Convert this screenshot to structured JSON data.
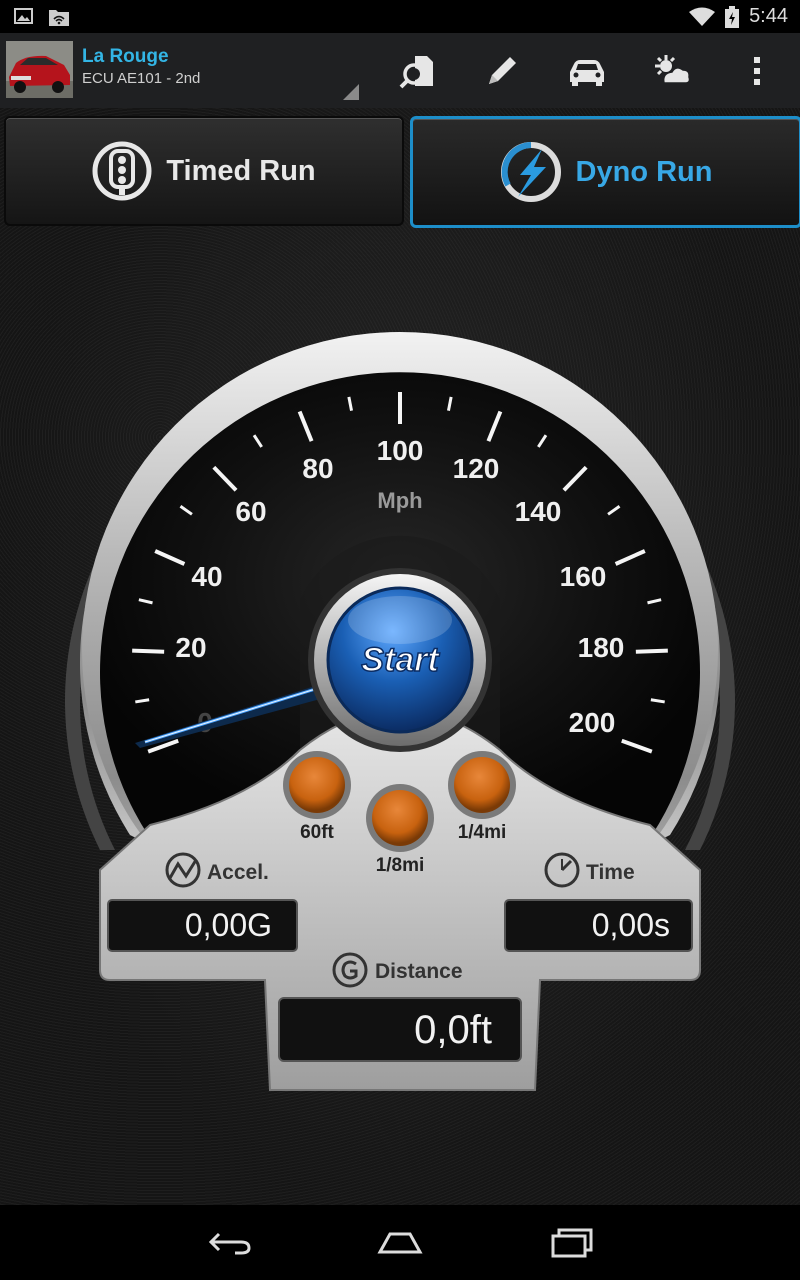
{
  "status_bar": {
    "time": "5:44",
    "icons": [
      "image-icon",
      "wifi-file-icon",
      "wifi-icon",
      "battery-charging-icon"
    ]
  },
  "action_bar": {
    "title": "La Rouge",
    "subtitle": "ECU AE101 - 2nd",
    "actions": [
      "diagnostic-scan-icon",
      "pencil-icon",
      "car-icon",
      "weather-sun-cloud-icon",
      "overflow-menu-icon"
    ]
  },
  "tabs": [
    {
      "label": "Timed Run",
      "selected": false,
      "icon": "traffic-light-icon"
    },
    {
      "label": "Dyno Run",
      "selected": true,
      "icon": "dyno-lightning-icon"
    }
  ],
  "gauge": {
    "unit": "Mph",
    "ticks": [
      "0",
      "20",
      "40",
      "60",
      "80",
      "100",
      "120",
      "140",
      "160",
      "180",
      "200"
    ],
    "needle_value": 0,
    "start_label": "Start",
    "lights": [
      {
        "label": "60ft"
      },
      {
        "label": "1/8mi"
      },
      {
        "label": "1/4mi"
      }
    ],
    "accel_label": "Accel.",
    "accel_value": "0,00G",
    "time_label": "Time",
    "time_value": "0,00s",
    "distance_label": "Distance",
    "distance_value": "0,0ft"
  },
  "nav_bar": {
    "buttons": [
      "back-icon",
      "home-icon",
      "recent-apps-icon"
    ]
  },
  "colors": {
    "accent": "#33b5e5",
    "tab_selected_border": "#1d8ec9",
    "start_button": "#1a5fb4",
    "indicator_light": "#c8620f"
  }
}
